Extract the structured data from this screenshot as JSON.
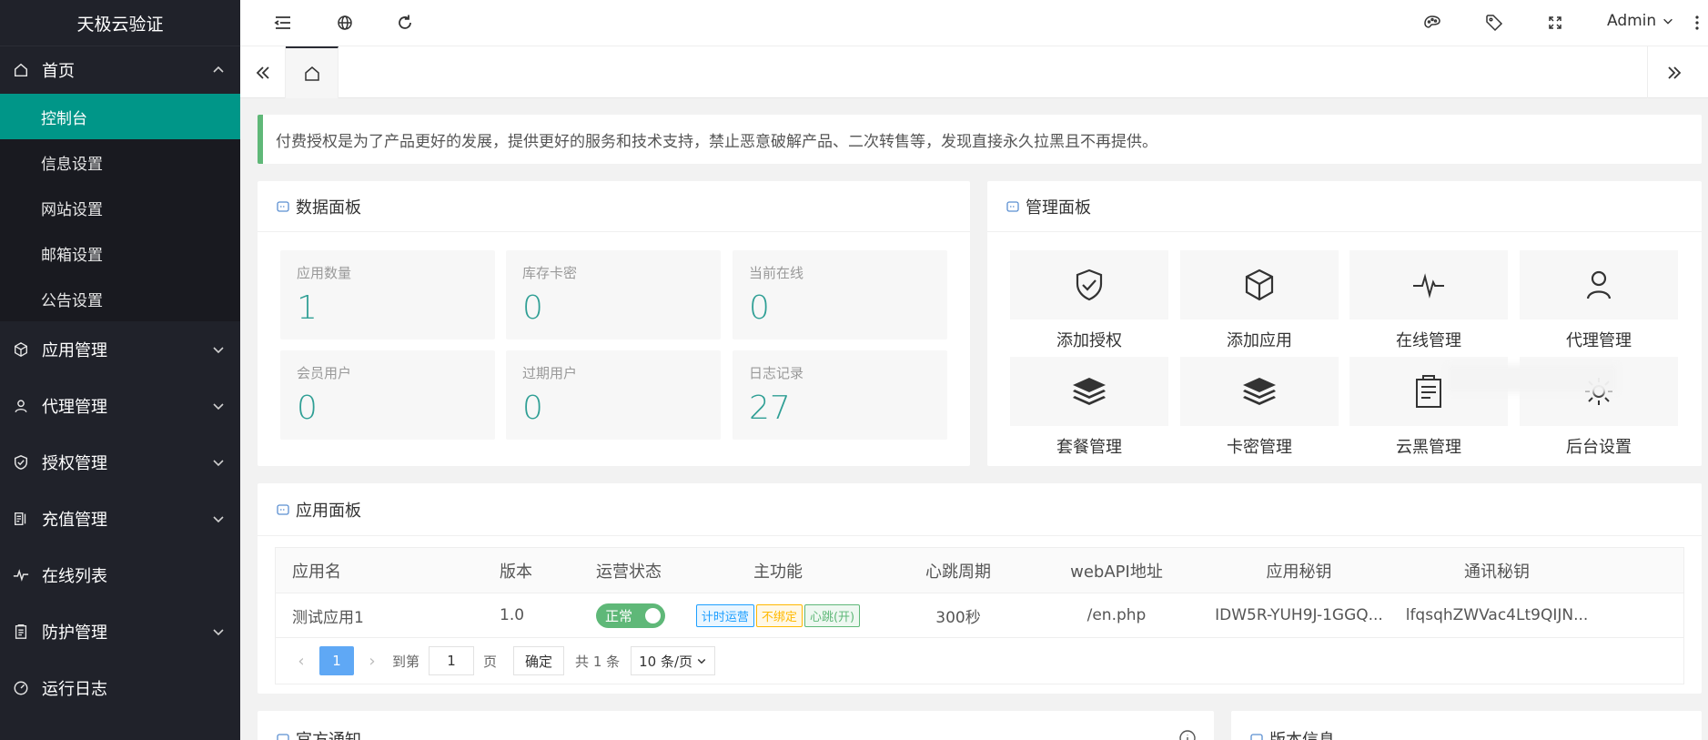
{
  "app": {
    "title": "天极云验证"
  },
  "sidebar": {
    "home": {
      "label": "首页",
      "icon": "home-icon"
    },
    "sub_items": [
      {
        "label": "控制台",
        "active": true
      },
      {
        "label": "信息设置"
      },
      {
        "label": "网站设置"
      },
      {
        "label": "邮箱设置"
      },
      {
        "label": "公告设置"
      }
    ],
    "items": [
      {
        "label": "应用管理",
        "icon": "cube-icon"
      },
      {
        "label": "代理管理",
        "icon": "user-icon"
      },
      {
        "label": "授权管理",
        "icon": "shield-check-icon"
      },
      {
        "label": "充值管理",
        "icon": "recharge-icon"
      },
      {
        "label": "在线列表",
        "icon": "pulse-icon"
      },
      {
        "label": "防护管理",
        "icon": "clipboard-icon"
      },
      {
        "label": "运行日志",
        "icon": "gauge-icon"
      }
    ]
  },
  "header": {
    "user": "Admin"
  },
  "notice": "付费授权是为了产品更好的发展，提供更好的服务和技术支持，禁止恶意破解产品、二次转售等，发现直接永久拉黑且不再提供。",
  "data_panel": {
    "title": "数据面板",
    "stats": [
      {
        "label": "应用数量",
        "value": "1"
      },
      {
        "label": "库存卡密",
        "value": "0"
      },
      {
        "label": "当前在线",
        "value": "0"
      },
      {
        "label": "会员用户",
        "value": "0"
      },
      {
        "label": "过期用户",
        "value": "0"
      },
      {
        "label": "日志记录",
        "value": "27"
      }
    ]
  },
  "manage_panel": {
    "title": "管理面板",
    "tiles": [
      {
        "label": "添加授权",
        "icon": "shield-check-icon"
      },
      {
        "label": "添加应用",
        "icon": "cube-icon"
      },
      {
        "label": "在线管理",
        "icon": "pulse-icon"
      },
      {
        "label": "代理管理",
        "icon": "user-icon"
      },
      {
        "label": "套餐管理",
        "icon": "layers-icon"
      },
      {
        "label": "卡密管理",
        "icon": "layers-icon"
      },
      {
        "label": "云黑管理",
        "icon": "clipboard-icon"
      },
      {
        "label": "后台设置",
        "icon": "gear-icon"
      }
    ]
  },
  "app_panel": {
    "title": "应用面板",
    "columns": [
      "应用名",
      "版本",
      "运营状态",
      "主功能",
      "心跳周期",
      "webAPI地址",
      "应用秘钥",
      "通讯秘钥"
    ],
    "rows": [
      {
        "name": "测试应用1",
        "version": "1.0",
        "status": "正常",
        "features": [
          "计时运营",
          "不绑定",
          "心跳(开)"
        ],
        "heartbeat": "300秒",
        "api": "/en.php",
        "app_key": "IDW5R-YUH9J-1GGQ...",
        "comm_key": "lfqsqhZWVac4Lt9QIJN..."
      }
    ],
    "pager": {
      "page": "1",
      "goto_label": "到第",
      "goto_value": "1",
      "page_unit": "页",
      "confirm": "确定",
      "total": "共 1 条",
      "per_page": "10 条/页"
    }
  },
  "bottom_cards": {
    "left_title": "官方通知",
    "right_title": "版本信息"
  }
}
